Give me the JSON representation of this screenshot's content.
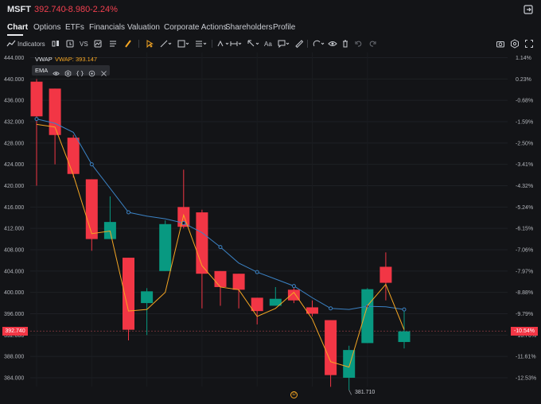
{
  "header": {
    "ticker": "MSFT",
    "price": "392.740",
    "change": "-8.980",
    "change_pct": "-2.24%",
    "accent_down": "#f23645",
    "accent_up": "#089981"
  },
  "tabs": [
    {
      "label": "Chart",
      "active": true
    },
    {
      "label": "Options"
    },
    {
      "label": "ETFs"
    },
    {
      "label": "Financials"
    },
    {
      "label": "Valuation"
    },
    {
      "label": "Corporate Actions"
    },
    {
      "label": "Shareholders"
    },
    {
      "label": "Profile"
    }
  ],
  "toolbar": {
    "indicators_label": "Indicators",
    "compare_label": "VS",
    "text_tool_label": "Aa"
  },
  "indicators": {
    "vwap_name": "VWAP",
    "vwap_value": "VWAP: 393.147",
    "ema_name": "EMA"
  },
  "axes": {
    "price_ticks": [
      "444.000",
      "440.000",
      "436.000",
      "432.000",
      "428.000",
      "424.000",
      "420.000",
      "416.000",
      "412.000",
      "408.000",
      "404.000",
      "400.000",
      "396.000",
      "392.000",
      "388.000",
      "384.000"
    ],
    "pct_ticks": [
      "1.14%",
      "0.23%",
      "-0.68%",
      "-1.59%",
      "-2.50%",
      "-3.41%",
      "-4.32%",
      "-5.24%",
      "-6.15%",
      "-7.06%",
      "-7.97%",
      "-8.88%",
      "-9.79%",
      "-10.70%",
      "-11.61%",
      "-12.53%"
    ],
    "current_price": "392.740",
    "current_pct": "-10.54%",
    "low_label": "381.710"
  },
  "chart_data": {
    "type": "candlestick",
    "series": [
      {
        "o": 439.5,
        "h": 440.0,
        "l": 420.0,
        "c": 433.0
      },
      {
        "o": 438.2,
        "h": 438.2,
        "l": 424.0,
        "c": 429.5
      },
      {
        "o": 429.0,
        "h": 429.5,
        "l": 421.5,
        "c": 422.2
      },
      {
        "o": 421.2,
        "h": 421.2,
        "l": 407.8,
        "c": 410.0
      },
      {
        "o": 410.0,
        "h": 418.0,
        "l": 410.0,
        "c": 413.2
      },
      {
        "o": 406.5,
        "h": 406.5,
        "l": 391.0,
        "c": 393.0
      },
      {
        "o": 398.0,
        "h": 400.8,
        "l": 392.0,
        "c": 400.2
      },
      {
        "o": 404.0,
        "h": 413.5,
        "l": 404.0,
        "c": 412.8
      },
      {
        "o": 416.0,
        "h": 423.0,
        "l": 412.0,
        "c": 412.3
      },
      {
        "o": 415.0,
        "h": 415.5,
        "l": 397.0,
        "c": 403.5
      },
      {
        "o": 404.0,
        "h": 404.0,
        "l": 397.5,
        "c": 401.0
      },
      {
        "o": 403.5,
        "h": 403.5,
        "l": 397.0,
        "c": 400.5
      },
      {
        "o": 399.0,
        "h": 399.0,
        "l": 394.0,
        "c": 396.5
      },
      {
        "o": 397.5,
        "h": 401.0,
        "l": 397.5,
        "c": 398.8
      },
      {
        "o": 400.5,
        "h": 401.5,
        "l": 398.0,
        "c": 398.5
      },
      {
        "o": 397.2,
        "h": 398.5,
        "l": 395.5,
        "c": 396.0
      },
      {
        "o": 394.8,
        "h": 394.8,
        "l": 382.3,
        "c": 384.5
      },
      {
        "o": 384.0,
        "h": 390.0,
        "l": 381.7,
        "c": 389.2
      },
      {
        "o": 390.5,
        "h": 400.8,
        "l": 390.5,
        "c": 400.6
      },
      {
        "o": 404.8,
        "h": 407.5,
        "l": 398.5,
        "c": 401.8
      },
      {
        "o": 390.7,
        "h": 396.5,
        "l": 389.5,
        "c": 392.7
      }
    ],
    "vwap": [
      432.5,
      431.7,
      430.0,
      424.0,
      419.5,
      415.0,
      414.3,
      413.8,
      413.0,
      411.2,
      408.5,
      405.5,
      403.8,
      402.5,
      401.2,
      399.0,
      397.0,
      396.8,
      397.4,
      397.3,
      396.8
    ],
    "ema": [
      431.5,
      431.0,
      422.0,
      411.0,
      411.5,
      396.5,
      396.8,
      400.0,
      414.5,
      405.0,
      401.0,
      400.5,
      395.5,
      397.0,
      400.0,
      395.0,
      387.0,
      386.0,
      397.5,
      401.5,
      393.0
    ],
    "markers_on_vwap": [
      0,
      3,
      5,
      8,
      10,
      12,
      14,
      16,
      18,
      20
    ],
    "ylim": [
      382.0,
      445.5
    ],
    "title": ""
  }
}
